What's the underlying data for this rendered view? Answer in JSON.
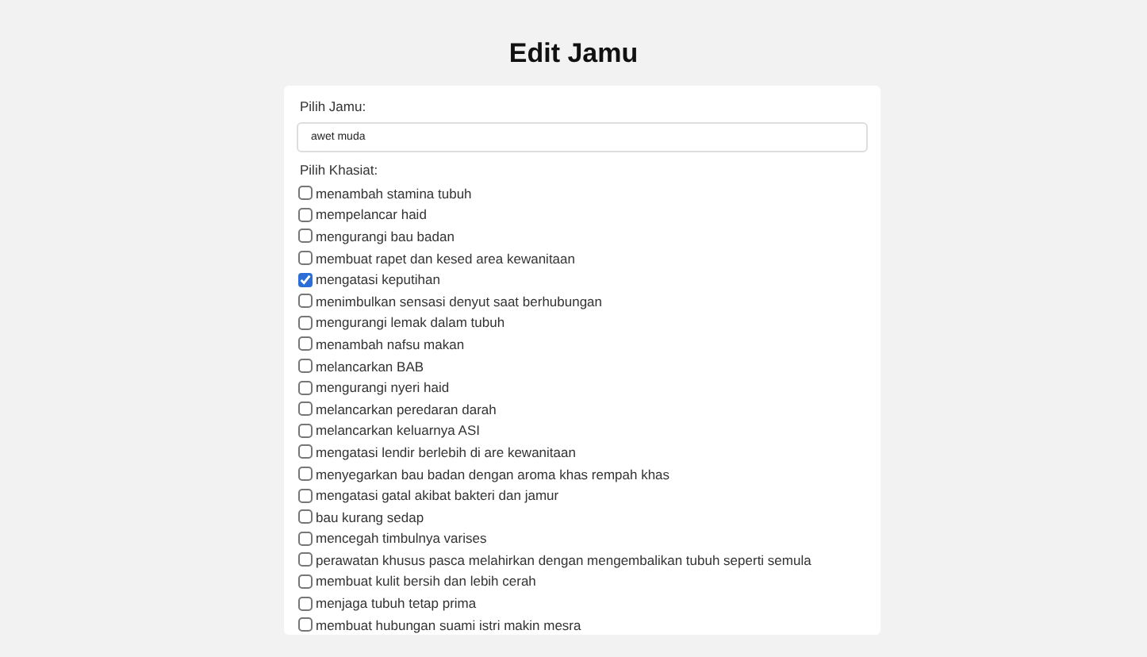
{
  "title": "Edit Jamu",
  "jamu_label": "Pilih Jamu:",
  "jamu_field": {
    "value": "awet muda"
  },
  "khasiat_label": "Pilih Khasiat:",
  "khasiat": [
    {
      "label": "menambah stamina tubuh",
      "checked": false
    },
    {
      "label": "mempelancar haid",
      "checked": false
    },
    {
      "label": "mengurangi bau badan",
      "checked": false
    },
    {
      "label": "membuat rapet dan kesed area kewanitaan",
      "checked": false
    },
    {
      "label": "mengatasi keputihan",
      "checked": true
    },
    {
      "label": "menimbulkan sensasi denyut saat berhubungan",
      "checked": false
    },
    {
      "label": "mengurangi lemak dalam tubuh",
      "checked": false
    },
    {
      "label": "menambah nafsu makan",
      "checked": false
    },
    {
      "label": "melancarkan BAB",
      "checked": false
    },
    {
      "label": "mengurangi nyeri haid",
      "checked": false
    },
    {
      "label": "melancarkan peredaran darah",
      "checked": false
    },
    {
      "label": "melancarkan keluarnya ASI",
      "checked": false
    },
    {
      "label": "mengatasi lendir berlebih di are kewanitaan",
      "checked": false
    },
    {
      "label": "menyegarkan bau badan dengan aroma khas rempah khas",
      "checked": false
    },
    {
      "label": "mengatasi gatal akibat bakteri dan jamur",
      "checked": false
    },
    {
      "label": "bau kurang sedap",
      "checked": false
    },
    {
      "label": "mencegah timbulnya varises",
      "checked": false
    },
    {
      "label": "perawatan khusus pasca melahirkan dengan mengembalikan tubuh seperti semula",
      "checked": false
    },
    {
      "label": "membuat kulit bersih dan lebih cerah",
      "checked": false
    },
    {
      "label": "menjaga tubuh tetap prima",
      "checked": false
    },
    {
      "label": "membuat hubungan suami istri makin mesra",
      "checked": false
    }
  ]
}
